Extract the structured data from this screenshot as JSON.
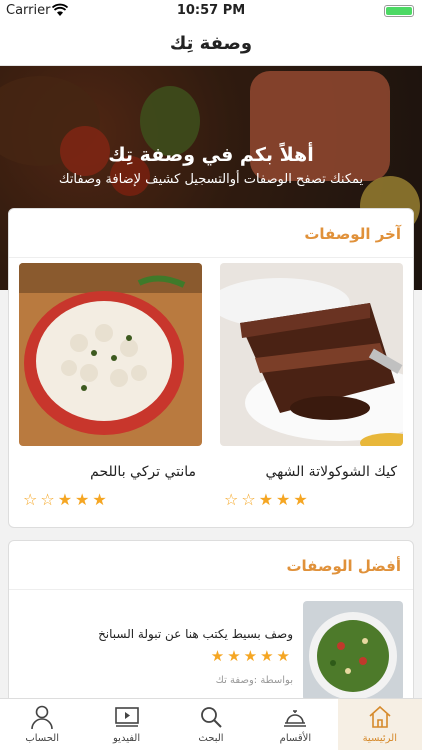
{
  "status": {
    "carrier": "Carrier",
    "time": "10:57 PM"
  },
  "nav": {
    "title": "وصفة تِك"
  },
  "hero": {
    "title": "أهلاً بكم في وصفة تِك",
    "subtitle": "يمكنك تصفح الوصفات أوالتسجيل كشيف لإضافة وصفاتك"
  },
  "latest": {
    "title": "آخر الوصفات",
    "recipes": [
      {
        "name": "كيك الشوكولاتة الشهي",
        "rating": 3,
        "max": 5
      },
      {
        "name": "مانتي تركي باللحم",
        "rating": 3,
        "max": 5
      }
    ]
  },
  "best": {
    "title": "أفضل الوصفات",
    "item": {
      "description": "وصف بسيط يكتب هنا عن تبولة السبانخ",
      "rating": 5,
      "max": 5,
      "author": "بواسطة :وصفة تك"
    }
  },
  "tabs": [
    {
      "label": "الرئيسية",
      "icon": "home-icon",
      "active": true
    },
    {
      "label": "الأقسام",
      "icon": "dish-icon",
      "active": false
    },
    {
      "label": "البحث",
      "icon": "search-icon",
      "active": false
    },
    {
      "label": "الفيديو",
      "icon": "video-icon",
      "active": false
    },
    {
      "label": "الحساب",
      "icon": "user-icon",
      "active": false
    }
  ],
  "colors": {
    "accent": "#e0913a",
    "star": "#f5a623",
    "active_tab": "#d68a2c"
  }
}
